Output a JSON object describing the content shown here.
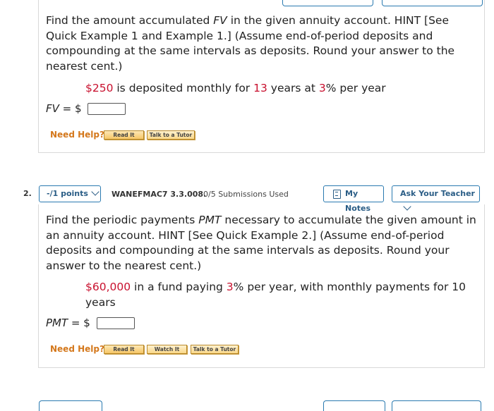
{
  "q1": {
    "prompt": "Find the amount accumulated FV in the given annuity account. HINT [See Quick Example 1 and Example 1.] (Assume end-of-period deposits and compounding at the same intervals as deposits. Round your answer to the nearest cent.)",
    "given_parts": [
      "$250",
      " is deposited monthly for ",
      "13",
      " years at ",
      "3",
      "% per year"
    ],
    "answer_var": "FV",
    "answer_eq": " = $",
    "need_help": "Need Help?",
    "buttons": [
      "Read It",
      "Talk to a Tutor"
    ]
  },
  "q2": {
    "number": "2.",
    "points": "-/1 points",
    "id": "WANEFMAC7 3.3.008.",
    "submissions": "0/5 Submissions Used",
    "my_notes": "My Notes",
    "ask_teacher": "Ask Your Teacher",
    "prompt": "Find the periodic payments PMT necessary to accumulate the given amount in an annuity account. HINT [See Quick Example 2.] (Assume end-of-period deposits and compounding at the same intervals as deposits. Round your answer to the nearest cent.)",
    "given_parts": [
      "$60,000",
      " in a fund paying ",
      "3",
      "% per year, with monthly payments for 10 years"
    ],
    "answer_var": "PMT",
    "answer_eq": " = $",
    "need_help": "Need Help?",
    "buttons": [
      "Read It",
      "Watch It",
      "Talk to a Tutor"
    ]
  },
  "colors": {
    "accent": "#2a7ab0",
    "help": "#d4781c",
    "highlight": "#c8102e"
  }
}
